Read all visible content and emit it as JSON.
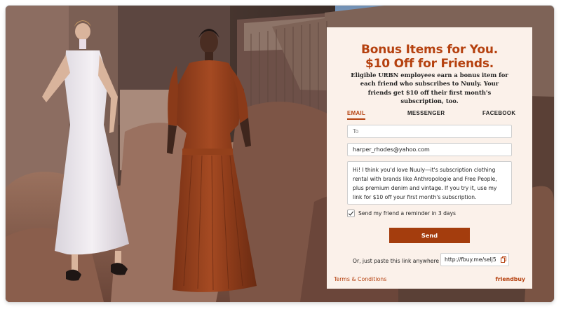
{
  "panel": {
    "headline_line1": "Bonus Items for You.",
    "headline_line2": "$10 Off for Friends.",
    "description": "Eligible URBN employees earn a bonus item for each friend who subscribes to Nuuly. Your friends get $10 off their first month's subscription, too.",
    "tabs": [
      {
        "label": "EMAIL",
        "active": true
      },
      {
        "label": "MESSENGER",
        "active": false
      },
      {
        "label": "FACEBOOK",
        "active": false
      }
    ],
    "to_placeholder": "To",
    "from_value": "harper_rhodes@yahoo.com",
    "message": "Hi! I think you'd love Nuuly—it's subscription clothing rental with brands like Anthropologie and Free People, plus premium denim and vintage. If you try it, use my link for $10 off your first month's subscription.",
    "reminder_label": "Send my friend a reminder in 3 days",
    "reminder_checked": true,
    "send_label": "Send",
    "paste_label": "Or, just paste this link anywhere",
    "share_link": "http://fbuy.me/selj5",
    "terms_label": "Terms & Conditions",
    "brand_label": "friendbuy"
  },
  "colors": {
    "accent": "#b5410f",
    "button": "#a43d0d",
    "panel_bg": "#fbf1ea"
  },
  "icons": {
    "checkmark": "checkmark-icon",
    "copy": "copy-icon"
  }
}
